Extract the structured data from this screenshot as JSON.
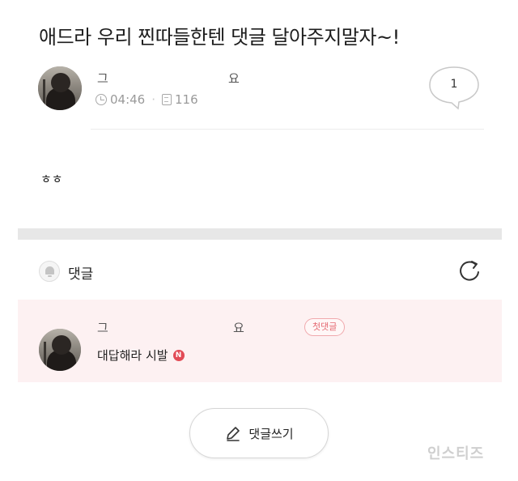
{
  "post": {
    "title": "애드라 우리 찐따들한텐 댓글 달아주지말자~!",
    "author_name": "그",
    "author_suffix": "요",
    "time": "04:46",
    "views": "116",
    "comment_count": "1",
    "body": "ㅎㅎ"
  },
  "comments": {
    "header_label": "댓글",
    "items": [
      {
        "author_name": "그",
        "author_suffix": "요",
        "badge": "첫댓글",
        "text": "대답해라 시발",
        "new_badge": "N"
      }
    ]
  },
  "write_button_label": "댓글쓰기",
  "watermark": "인스티즈",
  "colors": {
    "comment_highlight": "#fdf1f2",
    "badge_accent": "#e46a72",
    "new_badge": "#e24b56"
  },
  "icons": [
    "clock-icon",
    "document-icon",
    "speech-bubble-icon",
    "bell-icon",
    "refresh-icon",
    "pencil-icon"
  ]
}
